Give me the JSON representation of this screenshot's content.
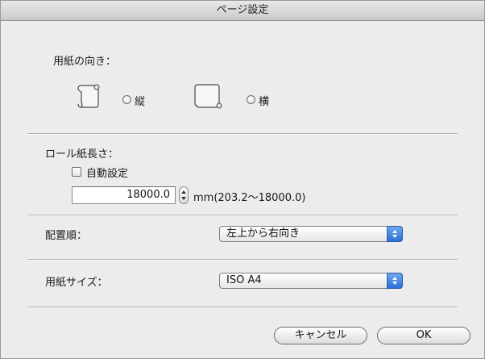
{
  "dialog": {
    "title": "ページ設定"
  },
  "orientation": {
    "label": "用紙の向き：",
    "portrait_label": "縦",
    "landscape_label": "横"
  },
  "roll_length": {
    "label": "ロール紙長さ：",
    "auto_label": "自動設定",
    "value": "18000.0",
    "range_label": "mm(203.2〜18000.0)"
  },
  "layout_order": {
    "label": "配置順：",
    "selected": "左上から右向き"
  },
  "paper_size": {
    "label": "用紙サイズ：",
    "selected": "ISO A4"
  },
  "buttons": {
    "cancel": "キャンセル",
    "ok": "OK"
  }
}
